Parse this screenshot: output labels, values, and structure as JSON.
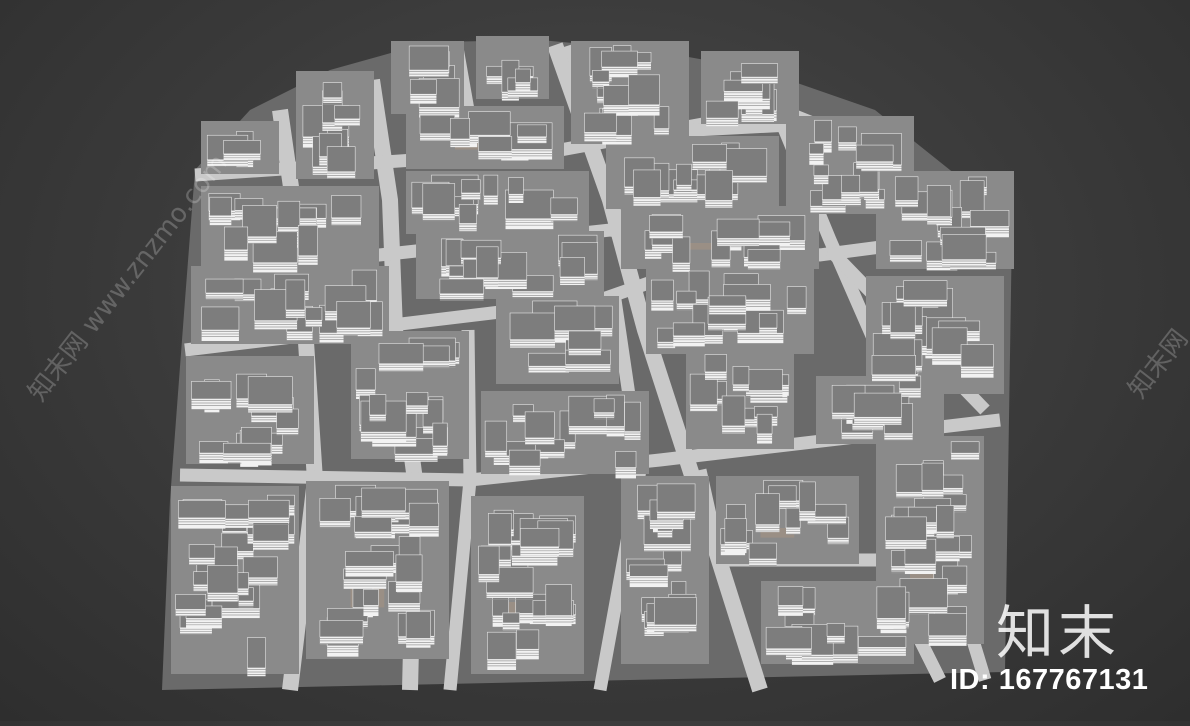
{
  "scene": {
    "colors": {
      "background": "#3a3a3a",
      "ground": "#6a6a6a",
      "road": "#c9c9c9",
      "building_roof": "#7d7d7d",
      "building_face": "#f2f2f2",
      "courtyard": "#9a8f85"
    }
  },
  "watermark": {
    "left_text": "知末网 www.znzmo.com",
    "right_text": "知末网"
  },
  "logo": {
    "text": "知末"
  },
  "id_label": {
    "text": "ID: 167767131"
  }
}
